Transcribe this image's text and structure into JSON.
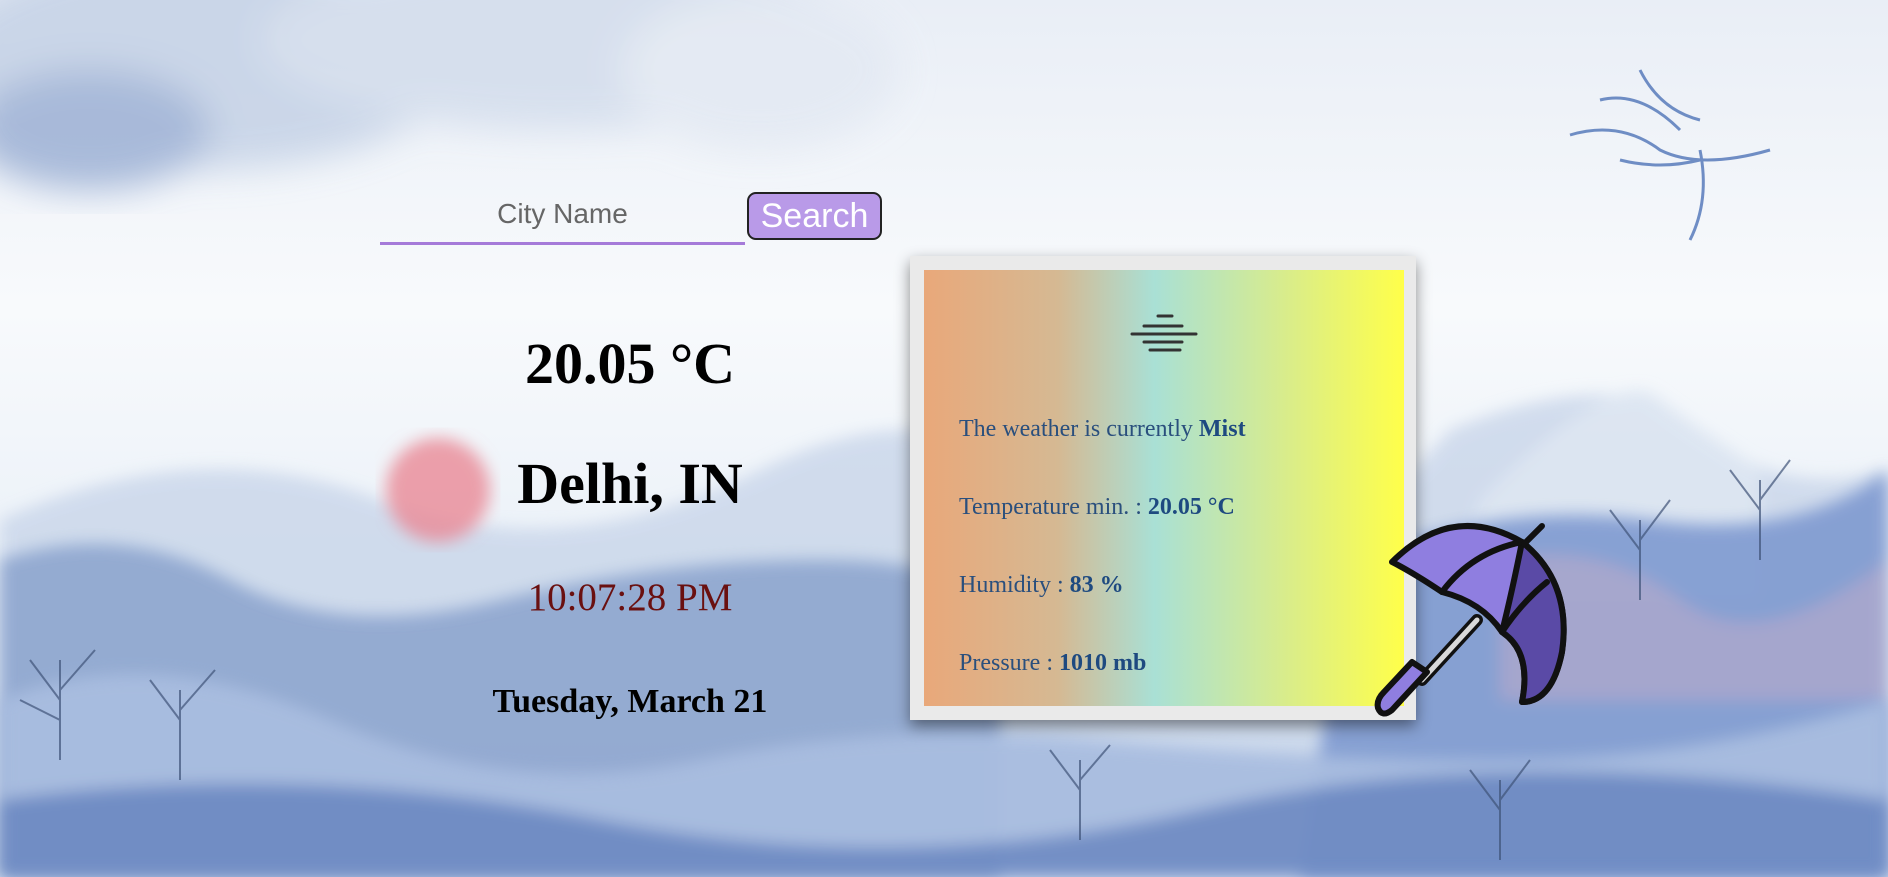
{
  "search": {
    "placeholder": "City Name",
    "button_label": "Search"
  },
  "current": {
    "temperature": "20.05 °C",
    "location": "Delhi, IN",
    "time": "10:07:28 PM",
    "date": "Tuesday, March 21"
  },
  "details": {
    "condition_icon": "mist-icon",
    "condition_prefix": "The weather is currently",
    "condition": "Mist",
    "temp_min_label": "Temperature min. :",
    "temp_min": "20.05 °C",
    "humidity_label": "Humidity :",
    "humidity": "83 %",
    "pressure_label": "Pressure :",
    "pressure": "1010 mb"
  },
  "decor": {
    "umbrella_icon": "umbrella-icon",
    "umbrella_colors": [
      "#8f7ee0",
      "#5a4aa6",
      "#000000"
    ]
  }
}
